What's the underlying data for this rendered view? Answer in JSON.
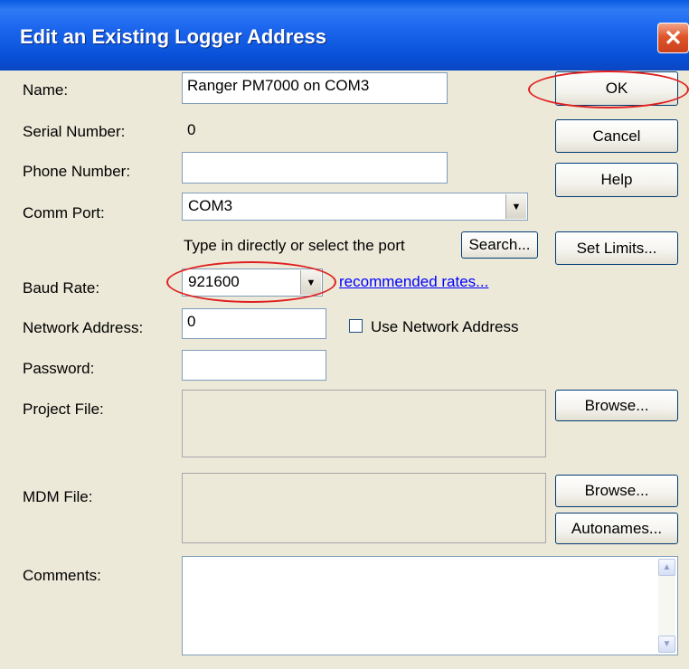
{
  "window": {
    "title": "Edit an Existing Logger Address",
    "close_glyph": "✕"
  },
  "fields": {
    "name": {
      "label": "Name:",
      "value": "Ranger PM7000 on COM3"
    },
    "serial": {
      "label": "Serial Number:",
      "value": "0"
    },
    "phone": {
      "label": "Phone Number:",
      "value": ""
    },
    "comm_port": {
      "label": "Comm Port:",
      "value": "COM3",
      "hint": "Type in directly or select the port"
    },
    "baud": {
      "label": "Baud Rate:",
      "value": "921600",
      "link": "recommended rates..."
    },
    "network": {
      "label": "Network Address:",
      "value": "0",
      "checkbox_label": "Use Network Address",
      "checked": false
    },
    "password": {
      "label": "Password:",
      "value": ""
    },
    "project_file": {
      "label": "Project File:",
      "value": ""
    },
    "mdm_file": {
      "label": "MDM File:",
      "value": ""
    },
    "comments": {
      "label": "Comments:",
      "value": ""
    }
  },
  "buttons": {
    "ok": "OK",
    "cancel": "Cancel",
    "help": "Help",
    "set_limits": "Set Limits...",
    "search": "Search...",
    "browse_project": "Browse...",
    "browse_mdm": "Browse...",
    "autonames": "Autonames..."
  },
  "icons": {
    "dropdown_arrow": "▼",
    "scroll_up": "▲",
    "scroll_down": "▼"
  },
  "colors": {
    "titlebar": "#0A5BE0",
    "dialog_bg": "#ECE9D8",
    "highlight_annotation": "#E02020",
    "link": "#0000FF"
  }
}
